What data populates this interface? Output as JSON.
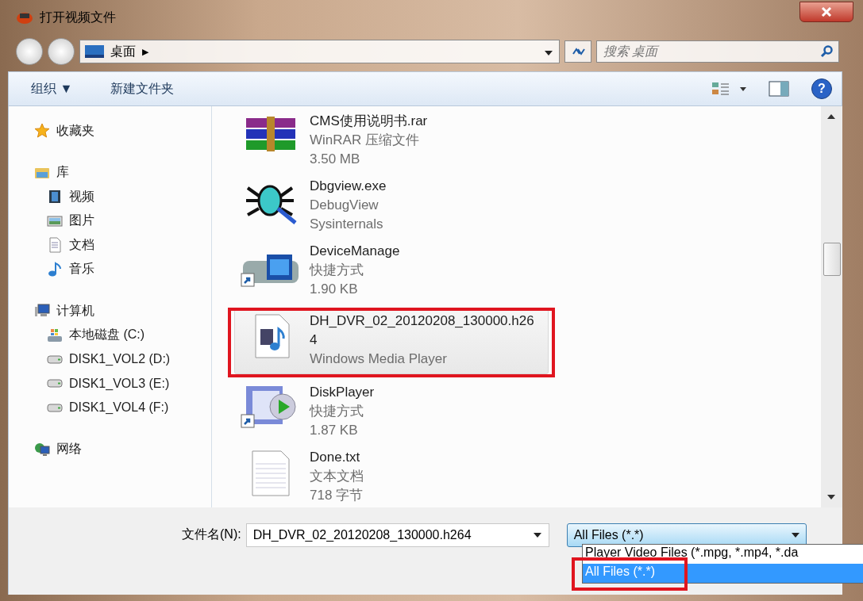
{
  "window": {
    "title": "打开视频文件"
  },
  "address_bar": {
    "location": "桌面",
    "separator": "▶"
  },
  "search": {
    "placeholder": "搜索 桌面"
  },
  "toolbar": {
    "organize": "组织 ▼",
    "new_folder": "新建文件夹",
    "help": "?"
  },
  "sidebar": {
    "groups": [
      {
        "label": "收藏夹"
      },
      {
        "label": "库",
        "children": [
          {
            "label": "视频"
          },
          {
            "label": "图片"
          },
          {
            "label": "文档"
          },
          {
            "label": "音乐"
          }
        ]
      },
      {
        "label": "计算机",
        "children": [
          {
            "label": "本地磁盘 (C:)"
          },
          {
            "label": "DISK1_VOL2 (D:)"
          },
          {
            "label": "DISK1_VOL3 (E:)"
          },
          {
            "label": "DISK1_VOL4 (F:)"
          }
        ]
      },
      {
        "label": "网络"
      }
    ]
  },
  "files": [
    {
      "name": "CMS使用说明书.rar",
      "lines": [
        "WinRAR 压缩文件",
        "3.50 MB"
      ],
      "kind": "archive",
      "selected": false,
      "highlighted": false
    },
    {
      "name": "Dbgview.exe",
      "lines": [
        "DebugView",
        "Sysinternals"
      ],
      "kind": "bug",
      "selected": false,
      "highlighted": false
    },
    {
      "name": "DeviceManage",
      "lines": [
        "快捷方式",
        "1.90 KB"
      ],
      "kind": "device-shortcut",
      "selected": false,
      "highlighted": false
    },
    {
      "name": "DH_DVR_02_20120208_130000.h264",
      "lines": [
        "Windows Media Player"
      ],
      "kind": "media",
      "selected": true,
      "highlighted": true
    },
    {
      "name": "DiskPlayer",
      "lines": [
        "快捷方式",
        "1.87 KB"
      ],
      "kind": "player-shortcut",
      "selected": false,
      "highlighted": false
    },
    {
      "name": "Done.txt",
      "lines": [
        "文本文档",
        "718 字节"
      ],
      "kind": "text",
      "selected": false,
      "highlighted": false
    }
  ],
  "filename": {
    "label": "文件名(N):",
    "value": "DH_DVR_02_20120208_130000.h264"
  },
  "file_type": {
    "value": "All Files (*.*)",
    "expanded": true,
    "options": [
      {
        "label": "Player Video Files (*.mpg, *.mp4, *.da",
        "selected": false,
        "highlighted": false
      },
      {
        "label": "All Files (*.*)",
        "selected": true,
        "highlighted": true
      }
    ]
  }
}
